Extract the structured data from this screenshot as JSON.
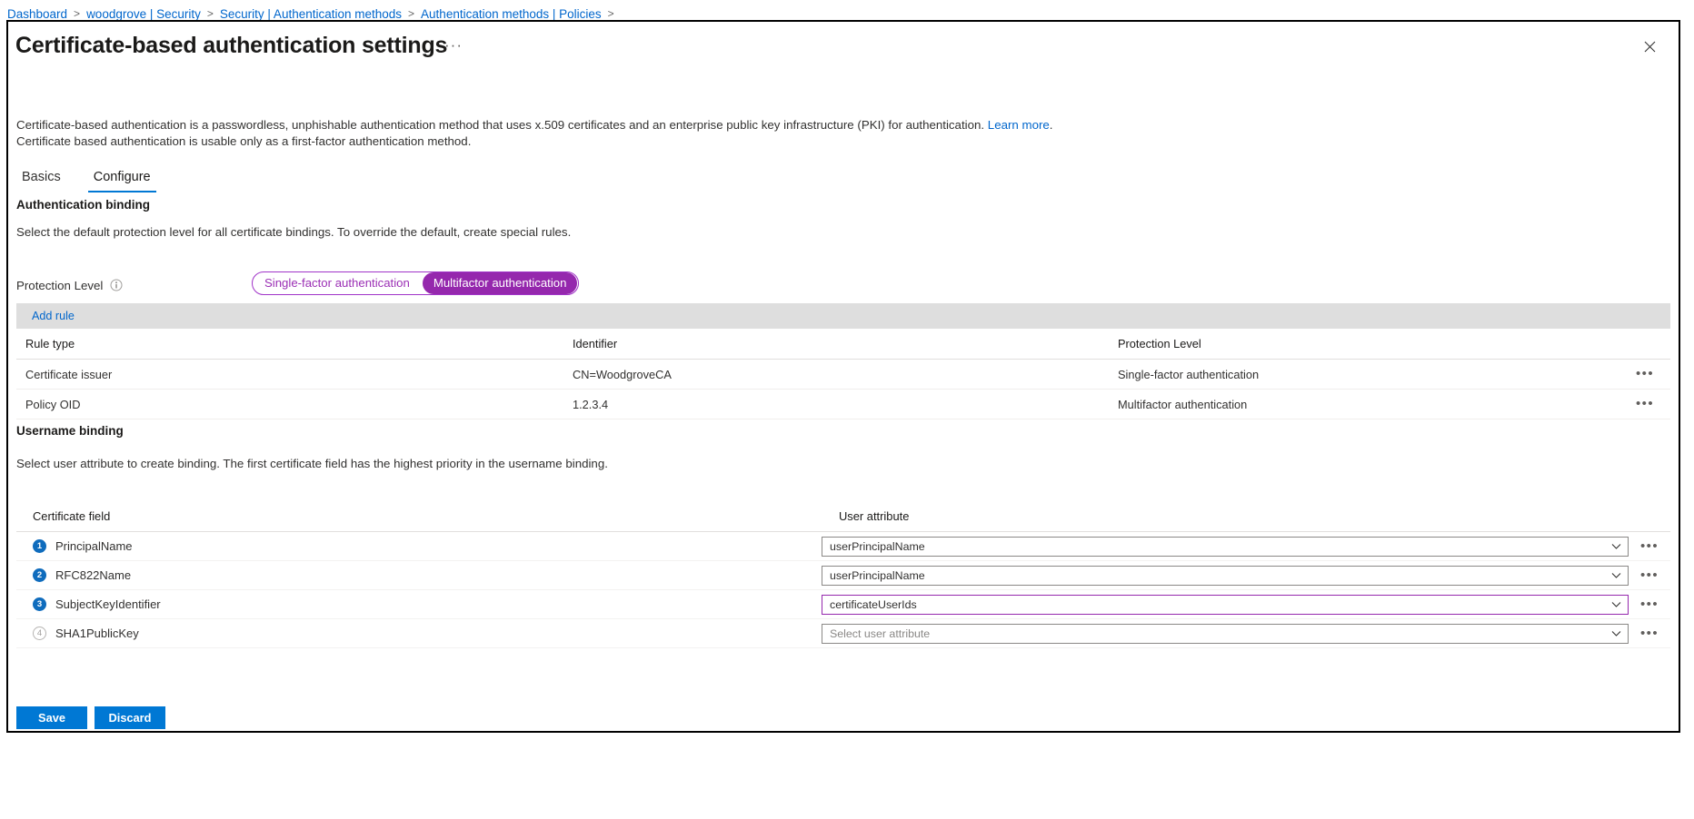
{
  "breadcrumb": {
    "items": [
      {
        "label": "Dashboard"
      },
      {
        "label": "woodgrove | Security"
      },
      {
        "label": "Security | Authentication methods"
      },
      {
        "label": "Authentication methods | Policies"
      }
    ],
    "separator": ">"
  },
  "header": {
    "title": "Certificate-based authentication settings",
    "more_label": "···",
    "close_icon": "close-icon"
  },
  "description": {
    "line1_text": "Certificate-based authentication is a passwordless, unphishable authentication method that uses x.509 certificates and an enterprise public key infrastructure (PKI) for authentication. ",
    "learn_more": "Learn more",
    "line1_end": ".",
    "line2": "Certificate based authentication is usable only as a first-factor authentication method."
  },
  "tabs": [
    {
      "label": "Basics",
      "active": false
    },
    {
      "label": "Configure",
      "active": true
    }
  ],
  "authentication_binding": {
    "heading": "Authentication binding",
    "subtext": "Select the default protection level for all certificate bindings. To override the default, create special rules.",
    "protection_level_label": "Protection Level",
    "info_icon": "info-icon",
    "options": [
      {
        "label": "Single-factor authentication",
        "selected": false
      },
      {
        "label": "Multifactor authentication",
        "selected": true
      }
    ],
    "accent_color": "#9528ad"
  },
  "rules_toolbar": {
    "add_rule_label": "Add rule"
  },
  "rules_table": {
    "columns": [
      "Rule type",
      "Identifier",
      "Protection Level"
    ],
    "rows": [
      {
        "rule_type": "Certificate issuer",
        "identifier": "CN=WoodgroveCA",
        "protection_level": "Single-factor authentication",
        "more_label": "•••"
      },
      {
        "rule_type": "Policy OID",
        "identifier": "1.2.3.4",
        "protection_level": "Multifactor authentication",
        "more_label": "•••"
      }
    ]
  },
  "username_binding": {
    "heading": "Username binding",
    "subtext": "Select user attribute to create binding. The first certificate field has the highest priority in the username binding.",
    "columns": [
      "Certificate field",
      "User attribute"
    ],
    "rows": [
      {
        "order": "1",
        "order_state": "active",
        "certificate_field": "PrincipalName",
        "user_attribute": "userPrincipalName",
        "placeholder": "Select user attribute",
        "is_placeholder": false,
        "focused": false,
        "more_label": "•••"
      },
      {
        "order": "2",
        "order_state": "active",
        "certificate_field": "RFC822Name",
        "user_attribute": "userPrincipalName",
        "placeholder": "Select user attribute",
        "is_placeholder": false,
        "focused": false,
        "more_label": "•••"
      },
      {
        "order": "3",
        "order_state": "active",
        "certificate_field": "SubjectKeyIdentifier",
        "user_attribute": "certificateUserIds",
        "placeholder": "Select user attribute",
        "is_placeholder": false,
        "focused": true,
        "more_label": "•••"
      },
      {
        "order": "4",
        "order_state": "disabled",
        "certificate_field": "SHA1PublicKey",
        "user_attribute": "Select user attribute",
        "placeholder": "Select user attribute",
        "is_placeholder": true,
        "focused": false,
        "more_label": "•••"
      }
    ]
  },
  "footer": {
    "save_label": "Save",
    "discard_label": "Discard",
    "primary_color": "#0078d4"
  }
}
